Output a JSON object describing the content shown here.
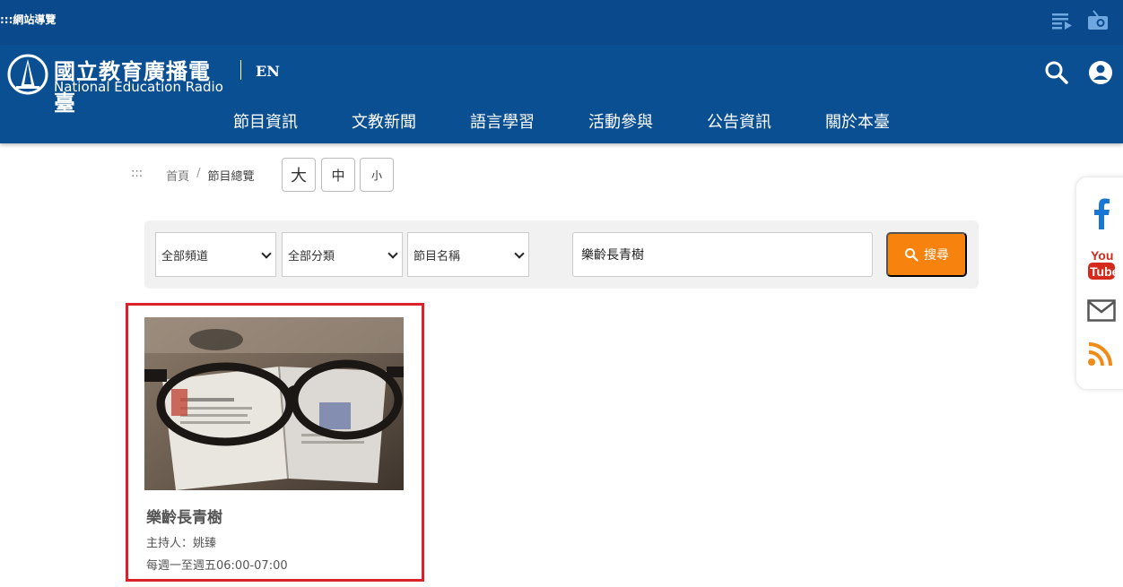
{
  "topbar": {
    "nav_guide": ":::網站導覽",
    "playlist_icon": "playlist-icon",
    "radio_icon": "radio-icon"
  },
  "header": {
    "logo_zh": "國立教育廣播電臺",
    "logo_en": "National Education Radio",
    "lang": "EN",
    "search_icon": "search-icon",
    "user_icon": "user-icon",
    "nav": [
      "節目資訊",
      "文教新聞",
      "語言學習",
      "活動參與",
      "公告資訊",
      "關於本臺"
    ]
  },
  "breadcrumb": {
    "marker": ":::",
    "home": "首頁",
    "separator": "/",
    "current": "節目總覽"
  },
  "font_size": {
    "large": "大",
    "medium": "中",
    "small": "小"
  },
  "search": {
    "channel_select": "全部頻道",
    "category_select": "全部分類",
    "field_select": "節目名稱",
    "query": "樂齡長青樹",
    "button_label": "搜尋"
  },
  "program": {
    "title": "樂齡長青樹",
    "host": "主持人：姚臻",
    "schedule": "每週一至週五06:00-07:00"
  },
  "social": [
    "facebook-icon",
    "youtube-icon",
    "mail-icon",
    "rss-icon"
  ],
  "colors": {
    "header_blue": "#0b4f93",
    "accent_orange": "#f7820e",
    "highlight_red": "#d9222a"
  }
}
